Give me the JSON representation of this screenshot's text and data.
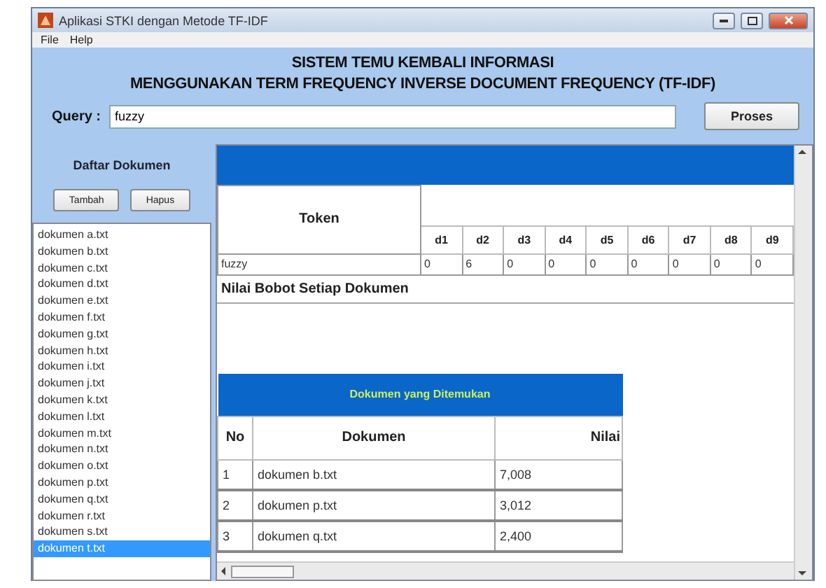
{
  "window": {
    "title": "Aplikasi STKI dengan Metode TF-IDF"
  },
  "menu": [
    "File",
    "Help"
  ],
  "heading": [
    "SISTEM TEMU KEMBALI INFORMASI",
    "MENGGUNAKAN TERM FREQUENCY INVERSE DOCUMENT FREQUENCY (TF-IDF)"
  ],
  "query": {
    "label": "Query :",
    "value": "fuzzy"
  },
  "process_button": "Proses",
  "documents": {
    "title": "Daftar Dokumen",
    "buttons": [
      "Tambah",
      "Hapus"
    ],
    "items": [
      {
        "label": "dokumen a.txt",
        "selected": false
      },
      {
        "label": "dokumen b.txt",
        "selected": false
      },
      {
        "label": "dokumen c.txt",
        "selected": false
      },
      {
        "label": "dokumen d.txt",
        "selected": false
      },
      {
        "label": "dokumen e.txt",
        "selected": false
      },
      {
        "label": "dokumen f.txt",
        "selected": false
      },
      {
        "label": "dokumen g.txt",
        "selected": false
      },
      {
        "label": "dokumen h.txt",
        "selected": false
      },
      {
        "label": "dokumen i.txt",
        "selected": false
      },
      {
        "label": "dokumen j.txt",
        "selected": false
      },
      {
        "label": "dokumen k.txt",
        "selected": false
      },
      {
        "label": "dokumen l.txt",
        "selected": false
      },
      {
        "label": "dokumen m.txt",
        "selected": false
      },
      {
        "label": "dokumen n.txt",
        "selected": false
      },
      {
        "label": "dokumen o.txt",
        "selected": false
      },
      {
        "label": "dokumen p.txt",
        "selected": false
      },
      {
        "label": "dokumen q.txt",
        "selected": false
      },
      {
        "label": "dokumen r.txt",
        "selected": false
      },
      {
        "label": "dokumen s.txt",
        "selected": false
      },
      {
        "label": "dokumen t.txt",
        "selected": true
      }
    ]
  },
  "token_table": {
    "token_header": "Token",
    "columns": [
      "d1",
      "d2",
      "d3",
      "d4",
      "d5",
      "d6",
      "d7",
      "d8",
      "d9"
    ],
    "rows": [
      {
        "token": "fuzzy",
        "values": [
          "0",
          "6",
          "0",
          "0",
          "0",
          "0",
          "0",
          "0",
          "0"
        ]
      }
    ]
  },
  "weights_label": "Nilai Bobot Setiap Dokumen",
  "results": {
    "title": "Dokumen yang Ditemukan",
    "columns": [
      "No",
      "Dokumen",
      "Nilai"
    ],
    "rows": [
      [
        "1",
        "dokumen b.txt",
        "7,008"
      ],
      [
        "2",
        "dokumen p.txt",
        "3,012"
      ],
      [
        "3",
        "dokumen q.txt",
        "2,400"
      ]
    ]
  }
}
